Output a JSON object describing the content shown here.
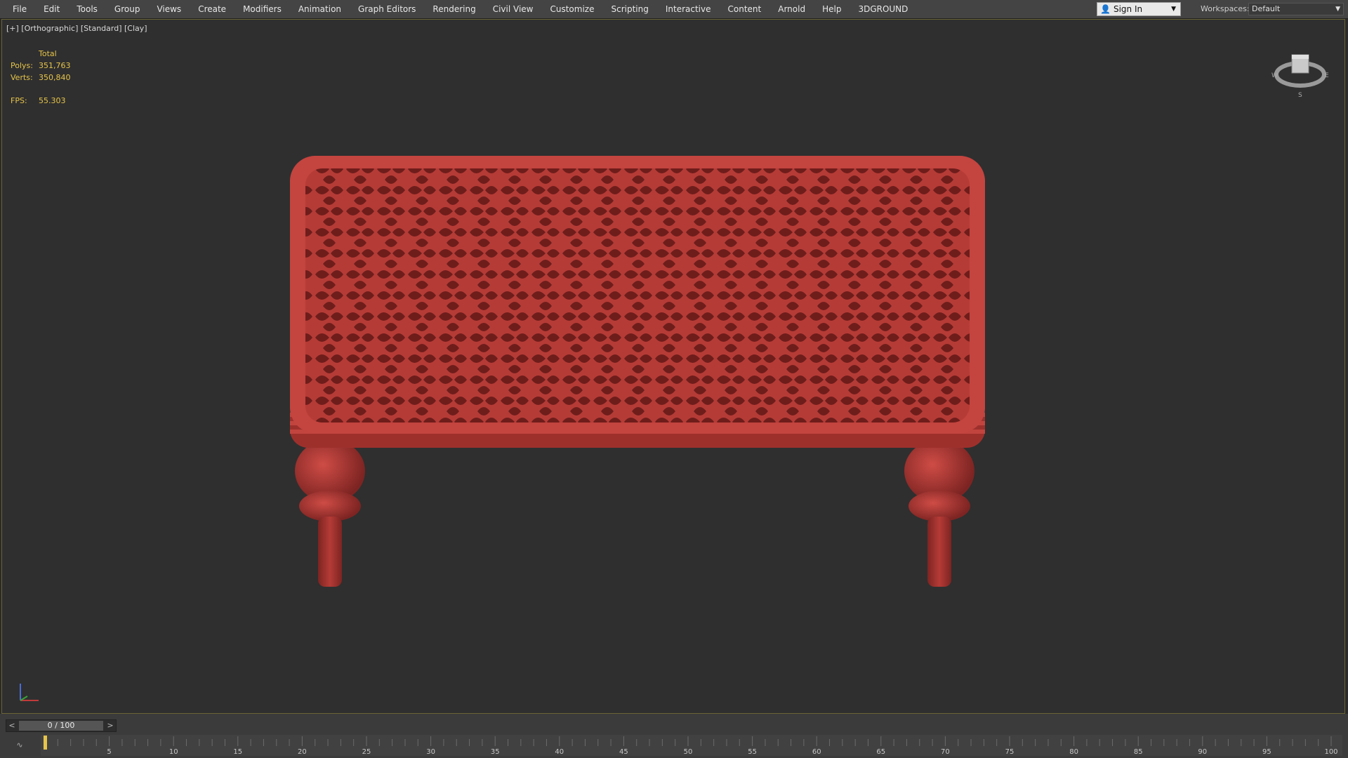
{
  "menubar": {
    "items": [
      "File",
      "Edit",
      "Tools",
      "Group",
      "Views",
      "Create",
      "Modifiers",
      "Animation",
      "Graph Editors",
      "Rendering",
      "Civil View",
      "Customize",
      "Scripting",
      "Interactive",
      "Content",
      "Arnold",
      "Help",
      "3DGROUND"
    ],
    "sign_in": "Sign In",
    "workspaces_label": "Workspaces:",
    "workspace_value": "Default"
  },
  "viewport": {
    "label": "[+] [Orthographic] [Standard] [Clay]",
    "stats": {
      "total_label": "Total",
      "polys_label": "Polys:",
      "polys_value": "351,763",
      "verts_label": "Verts:",
      "verts_value": "350,840",
      "fps_label": "FPS:",
      "fps_value": "55.303"
    },
    "viewcube": {
      "west": "W",
      "east": "E",
      "south": "S"
    },
    "model_color": "#b53b36"
  },
  "timeline": {
    "frame_display": "0 / 100",
    "prev": "<",
    "next": ">",
    "ticks": [
      "5",
      "10",
      "15",
      "20",
      "25",
      "30",
      "35",
      "40",
      "45",
      "50",
      "55",
      "60",
      "65",
      "70",
      "75",
      "80",
      "85",
      "90",
      "95",
      "100"
    ]
  },
  "colors": {
    "accent": "#e6c44a",
    "model": "#b53b36"
  }
}
